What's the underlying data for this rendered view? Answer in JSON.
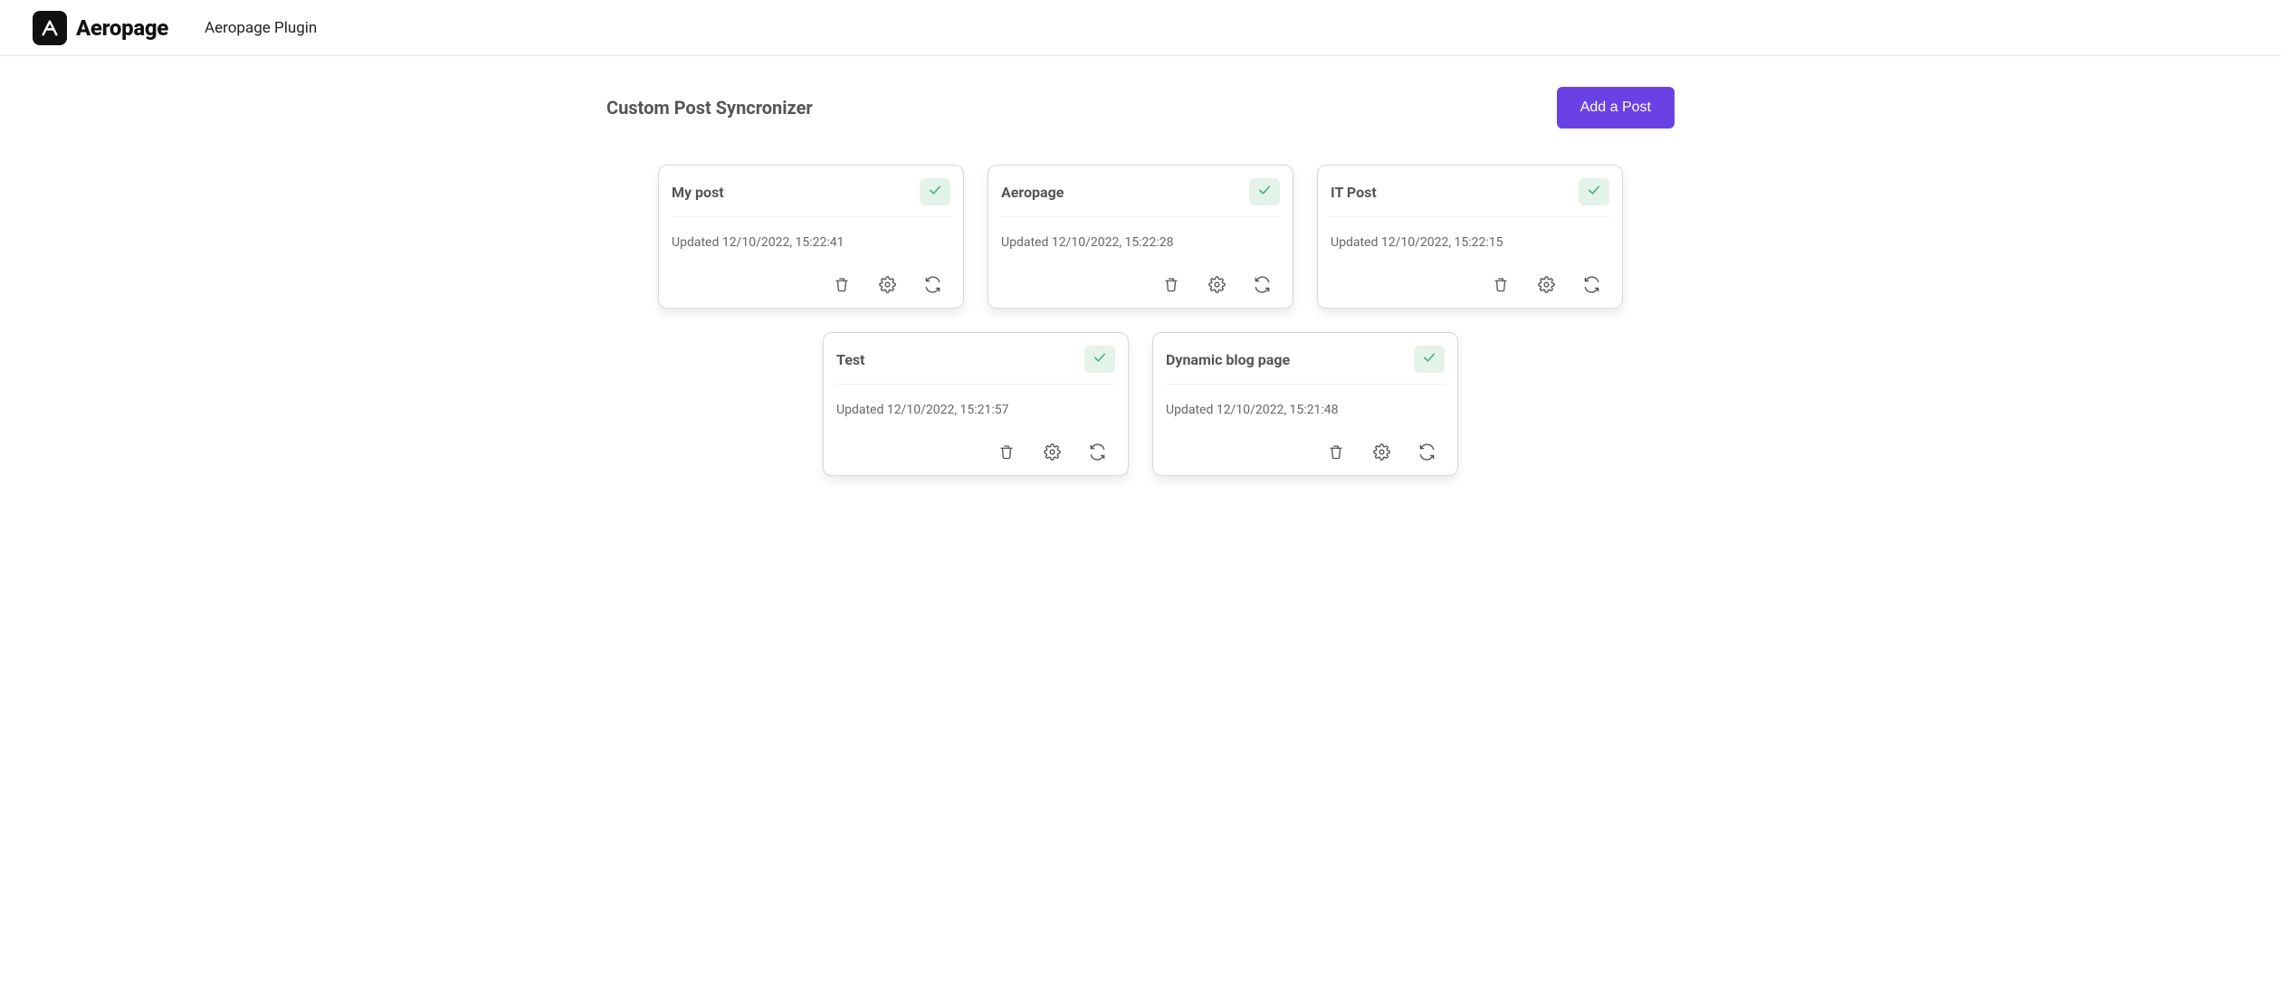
{
  "header": {
    "brand_name": "Aeropage",
    "page_subtitle": "Aeropage Plugin"
  },
  "main": {
    "section_title": "Custom Post Syncronizer",
    "add_button_label": "Add a Post"
  },
  "colors": {
    "accent": "#6a41e4",
    "status_ok_bg": "#e3f3ea",
    "status_ok_fg": "#4caf7a"
  },
  "cards": [
    {
      "title": "My post",
      "meta": "Updated 12/10/2022, 15:22:41",
      "status": "ok"
    },
    {
      "title": "Aeropage",
      "meta": "Updated 12/10/2022, 15:22:28",
      "status": "ok"
    },
    {
      "title": "IT Post",
      "meta": "Updated 12/10/2022, 15:22:15",
      "status": "ok"
    },
    {
      "title": "Test",
      "meta": "Updated 12/10/2022, 15:21:57",
      "status": "ok"
    },
    {
      "title": "Dynamic blog page",
      "meta": "Updated 12/10/2022, 15:21:48",
      "status": "ok"
    }
  ]
}
